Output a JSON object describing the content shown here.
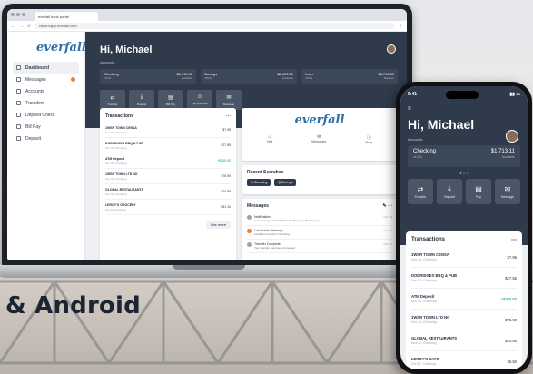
{
  "tagline": "& Android",
  "browser": {
    "tab_title": "everfall bank portal",
    "url": "https://app.everfall.com"
  },
  "brand": {
    "logo_text": "everfall",
    "accent": "#2d6fa8",
    "hero_bg": "#2f3b4a",
    "alert": "#ef7d2c"
  },
  "sidebar": {
    "items": [
      {
        "label": "Dashboard",
        "active": true
      },
      {
        "label": "Messages",
        "badge": true
      },
      {
        "label": "Accounts"
      },
      {
        "label": "Transfers"
      },
      {
        "label": "Deposit Check"
      },
      {
        "label": "Bill Pay"
      },
      {
        "label": "Deposit"
      }
    ]
  },
  "dashboard": {
    "greeting": "Hi, Michael",
    "accounts_label": "Accounts",
    "accounts": [
      {
        "name": "Checking",
        "balance": "$1,713.11",
        "sub": "x1234",
        "sub_right": "Available"
      },
      {
        "name": "Savings",
        "balance": "$8,903.31",
        "sub": "x5678",
        "sub_right": "Available"
      },
      {
        "name": "Loan",
        "balance": "$6,713.11",
        "sub": "x9012",
        "sub_right": "Balance"
      }
    ],
    "actions": [
      {
        "label": "Transfer",
        "icon": "transfer-icon"
      },
      {
        "label": "Deposit",
        "icon": "deposit-icon"
      },
      {
        "label": "Bill Pay",
        "icon": "bill-pay-icon"
      },
      {
        "label": "Pay a person",
        "icon": "pay-person-icon"
      },
      {
        "label": "Message",
        "icon": "message-icon"
      }
    ],
    "transactions_title": "Transactions",
    "transactions": [
      {
        "name": "1WSR TOWN CENSA",
        "date": "Nov 04, Checking",
        "amount": "$7.95",
        "positive": false
      },
      {
        "name": "DODRIDGES BBQ & PUB",
        "date": "Nov 03, Checking",
        "amount": "$27.55",
        "positive": false
      },
      {
        "name": "ATM Deposit",
        "date": "Nov 03, Checking",
        "amount": "+$300.00",
        "positive": true
      },
      {
        "name": "1WSR TOWN LTD NO",
        "date": "Nov 02, Checking",
        "amount": "$75.90",
        "positive": false
      },
      {
        "name": "GLOBAL RESTAURANTS",
        "date": "Nov 01, Checking",
        "amount": "$24.85",
        "positive": false
      },
      {
        "name": "LEROY'S GROCERY",
        "date": "Oct 31, Checking",
        "amount": "$51.10",
        "positive": false
      }
    ],
    "see_more": "See more",
    "brand_links": [
      {
        "label": "Visit",
        "icon": "location-icon"
      },
      {
        "label": "Messages",
        "icon": "mail-icon"
      },
      {
        "label": "More",
        "icon": "info-icon"
      }
    ],
    "recent_title": "Recent Searches",
    "recent_chips": [
      "Q Checking",
      "Q Savings"
    ],
    "messages_title": "Messages",
    "messages": [
      {
        "title": "Notifications",
        "sub": "An incoming card for Michael is Thursday (Tomorrow)",
        "when": "Nov 03",
        "warn": false
      },
      {
        "title": "Low Funds Warning",
        "sub": "Insufficient funds in Checking",
        "when": "Nov 02",
        "warn": true
      },
      {
        "title": "Transfer Complete",
        "sub": "Your transfer has been processed",
        "when": "Nov 01",
        "warn": false
      }
    ]
  },
  "phone": {
    "time": "9:41",
    "greeting": "Hi, Michael",
    "accounts_label": "Accounts",
    "account": {
      "name": "Checking",
      "sub": "x1234",
      "balance": "$1,713.11",
      "sub_right": "Available"
    },
    "pager": "● ○ ○",
    "actions": [
      {
        "label": "Transfer",
        "icon": "transfer-icon"
      },
      {
        "label": "Deposit",
        "icon": "deposit-icon"
      },
      {
        "label": "Pay",
        "icon": "pay-icon"
      },
      {
        "label": "Message",
        "icon": "message-icon"
      }
    ],
    "transactions_title": "Transactions",
    "transactions": [
      {
        "name": "1WSR TOWN CENSA",
        "date": "Nov 04, Checking",
        "amount": "$7.95",
        "positive": false
      },
      {
        "name": "DODRIDGES BBQ & PUB",
        "date": "Nov 03, Checking",
        "amount": "$27.55",
        "positive": false
      },
      {
        "name": "ATM Deposit",
        "date": "Nov 03, Checking",
        "amount": "+$300.00",
        "positive": true
      },
      {
        "name": "1WSR TOWN LTD NO",
        "date": "Nov 02, Checking",
        "amount": "$75.90",
        "positive": false
      },
      {
        "name": "GLOBAL RESTAURANTS",
        "date": "Nov 01, Checking",
        "amount": "$24.85",
        "positive": false
      },
      {
        "name": "LEROY'S CAFE",
        "date": "Oct 31, Checking",
        "amount": "$6.50",
        "positive": false
      }
    ]
  }
}
